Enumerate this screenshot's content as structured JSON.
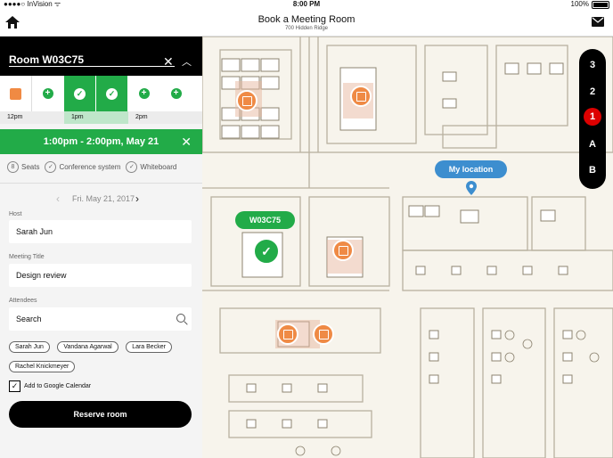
{
  "status_bar": {
    "carrier": "●●●●○ InVision ᯤ",
    "time": "8:00 PM",
    "battery": "100%"
  },
  "header": {
    "title": "Book a Meeting Room",
    "subtitle": "700 Hidden Ridge"
  },
  "room": {
    "name": "Room W03C75"
  },
  "timeline": {
    "labels": [
      "12pm",
      "1pm",
      "2pm"
    ]
  },
  "booking": {
    "time_range": "1:00pm - 2:00pm, May 21"
  },
  "amenities": [
    {
      "icon": "8",
      "label": "Seats"
    },
    {
      "icon": "✓",
      "label": "Conference system"
    },
    {
      "icon": "✓",
      "label": "Whiteboard"
    }
  ],
  "date": {
    "label": "Fri. May 21, 2017"
  },
  "form": {
    "host_label": "Host",
    "host_value": "Sarah Jun",
    "meeting_title_label": "Meeting Title",
    "meeting_title_value": "Design review",
    "attendees_label": "Attendees",
    "attendees_placeholder": "Search"
  },
  "attendees": [
    "Sarah Jun",
    "Vandana Agarwal",
    "Lara Becker",
    "Rachel Knickmeyer"
  ],
  "google_calendar": {
    "label": "Add to Google Calendar",
    "checked": true
  },
  "actions": {
    "reserve": "Reserve room"
  },
  "map": {
    "floors": [
      "3",
      "2",
      "1",
      "A",
      "B"
    ],
    "active_floor": "1",
    "my_location_label": "My location",
    "selected_room_label": "W03C75"
  },
  "colors": {
    "green": "#22ab48",
    "orange": "#ef8a45",
    "blue": "#3d8ecf",
    "red": "#dd1111"
  }
}
